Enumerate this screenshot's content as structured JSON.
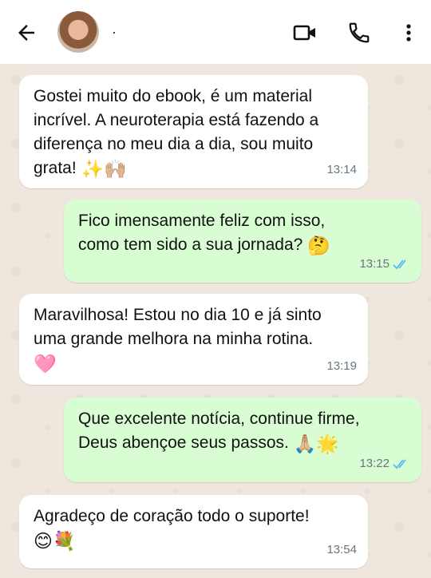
{
  "header": {
    "contact_name": "·",
    "icons": [
      "back-arrow-icon",
      "avatar",
      "video-call-icon",
      "phone-icon",
      "more-options-icon"
    ]
  },
  "messages": [
    {
      "direction": "incoming",
      "lines": [
        "Gostei muito do ebook, é um material",
        "incrível. A neuroterapia está fazendo a",
        "diferença no meu dia a dia, sou muito",
        "grata!"
      ],
      "emoji": "✨🙌🏼",
      "time": "13:14"
    },
    {
      "direction": "outgoing",
      "lines": [
        "Fico imensamente feliz com isso,",
        "como tem sido a sua jornada?"
      ],
      "emoji": "🤔",
      "time": "13:15",
      "read": true
    },
    {
      "direction": "incoming",
      "lines": [
        "Maravilhosa! Estou no dia 10 e já sinto",
        "uma grande melhora na minha rotina."
      ],
      "emoji": "🩷",
      "time": "13:19"
    },
    {
      "direction": "outgoing",
      "lines": [
        "Que excelente notícia, continue firme,",
        "Deus abençoe seus passos."
      ],
      "emoji": "🙏🏼🌟",
      "time": "13:22",
      "read": true
    },
    {
      "direction": "incoming",
      "lines": [
        "Agradeço de coração todo o suporte!"
      ],
      "emoji": "😊💐",
      "time": "13:54"
    }
  ],
  "colors": {
    "chat_bg": "#efe7de",
    "incoming_bubble": "#ffffff",
    "outgoing_bubble": "#d9fdd3",
    "read_ticks": "#53bdeb",
    "timestamp": "#667781"
  }
}
